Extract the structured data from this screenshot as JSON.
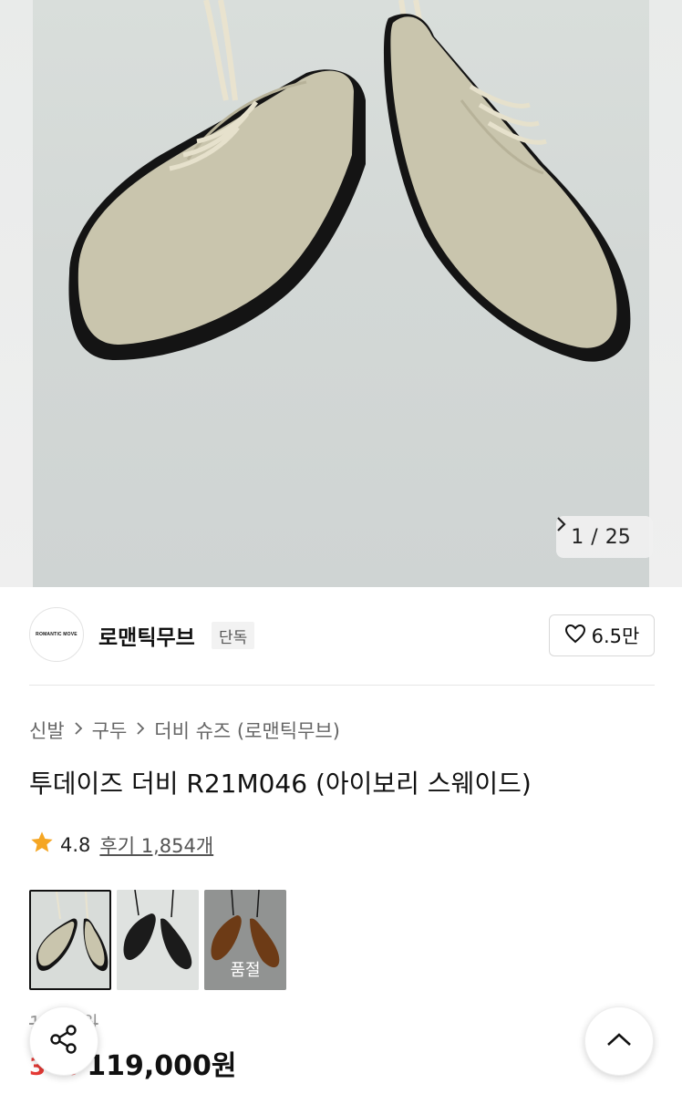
{
  "gallery": {
    "current": "1",
    "separator": "/",
    "total": "25"
  },
  "brand": {
    "logo_text": "ROMANTIC MOVE",
    "name": "로맨틱무브",
    "badge": "단독",
    "likes": "6.5만"
  },
  "breadcrumb": [
    "신발",
    "구두",
    "더비 슈즈 (로맨틱무브)"
  ],
  "product": {
    "title": "투데이즈 더비 R21M046 (아이보리 스웨이드)",
    "rating": "4.8",
    "review_label": "후기 1,854개",
    "thumbnails": [
      {
        "color": "ivory-suede",
        "sold_out": false
      },
      {
        "color": "black",
        "sold_out": false
      },
      {
        "color": "brown",
        "sold_out": true,
        "label": "품절"
      }
    ],
    "original_price": "1  ,   00원",
    "discount": "3 %",
    "price": "119,000원"
  },
  "icons": {
    "share": "share-icon",
    "scroll_top": "chevron-up-icon",
    "like": "heart-icon",
    "rating": "star-icon"
  },
  "colors": {
    "discount": "#e53935",
    "star": "#f5a623"
  }
}
